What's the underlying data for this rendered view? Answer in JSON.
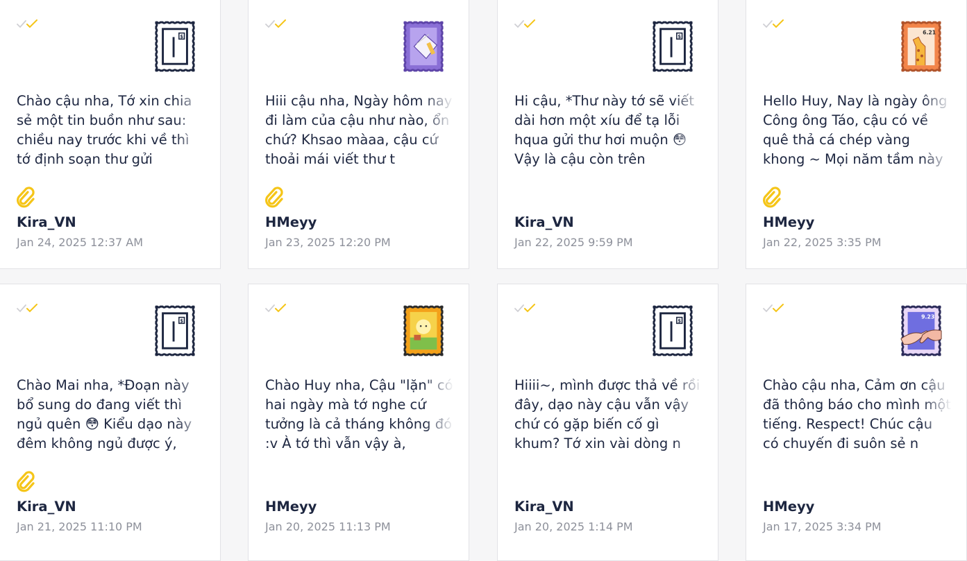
{
  "colors": {
    "accent_yellow": "#f5c518",
    "navy": "#1d2640",
    "muted": "#8d909a",
    "check_grey": "#cfcfd4"
  },
  "letters": [
    {
      "excerpt": "Chào cậu nha, Tớ xin chia sẻ một tin buồn như sau: chiều nay trước khi về thì tớ định soạn thư gửi",
      "author": "Kira_VN",
      "date": "Jan 24, 2025 12:37 AM",
      "stamp": "door-stamp-icon",
      "has_attachment": true
    },
    {
      "excerpt": "Hiii cậu nha, Ngày hôm nay đi làm của cậu như nào, ổn chứ? Khsao màaa, cậu cứ thoải mái viết thư t",
      "author": "HMeyy",
      "date": "Jan 23, 2025 12:20 PM",
      "stamp": "letter-envelope-stamp-icon",
      "has_attachment": true
    },
    {
      "excerpt": "Hi cậu, *Thư này tớ sẽ viết dài hơn một xíu để tạ lỗi hqua gửi thư hơi muộn 😳 Vậy là cậu còn trên",
      "author": "Kira_VN",
      "date": "Jan 22, 2025 9:59 PM",
      "stamp": "door-stamp-icon",
      "has_attachment": false
    },
    {
      "excerpt": "Hello Huy, Nay là ngày ông Công ông Táo, cậu có về quê thả cá chép vàng khong ~ Mọi năm tầm này là",
      "author": "HMeyy",
      "date": "Jan 22, 2025 3:35 PM",
      "stamp": "giraffe-stamp-icon",
      "stamp_text": "6.21",
      "has_attachment": true
    },
    {
      "excerpt": "Chào Mai nha, *Đoạn này bổ sung do đang viết thì ngủ quên 😳 Kiểu dạo này đêm không ngủ được ý,",
      "author": "Kira_VN",
      "date": "Jan 21, 2025 11:10 PM",
      "stamp": "door-stamp-icon",
      "has_attachment": true
    },
    {
      "excerpt": "Chào Huy nha, Cậu \"lặn\" có hai ngày mà tớ nghe cứ tưởng là cả tháng không đó :v À tớ thì vẫn vậy à,",
      "author": "HMeyy",
      "date": "Jan 20, 2025 11:13 PM",
      "stamp": "sunny-field-stamp-icon",
      "has_attachment": false
    },
    {
      "excerpt": "Hiiii~, mình được thả về rồi đây, dạo này cậu vẫn vậy chứ có gặp biến cố gì khum? Tớ xin vài dòng n",
      "author": "Kira_VN",
      "date": "Jan 20, 2025 1:14 PM",
      "stamp": "door-stamp-icon",
      "has_attachment": false
    },
    {
      "excerpt": "Chào cậu nha, Cảm ơn cậu đã thông báo cho mình một tiếng. Respect! Chúc cậu có chuyến đi suôn sẻ n",
      "author": "HMeyy",
      "date": "Jan 17, 2025 3:34 PM",
      "stamp": "hands-stamp-icon",
      "stamp_text": "9.23",
      "has_attachment": false
    }
  ]
}
